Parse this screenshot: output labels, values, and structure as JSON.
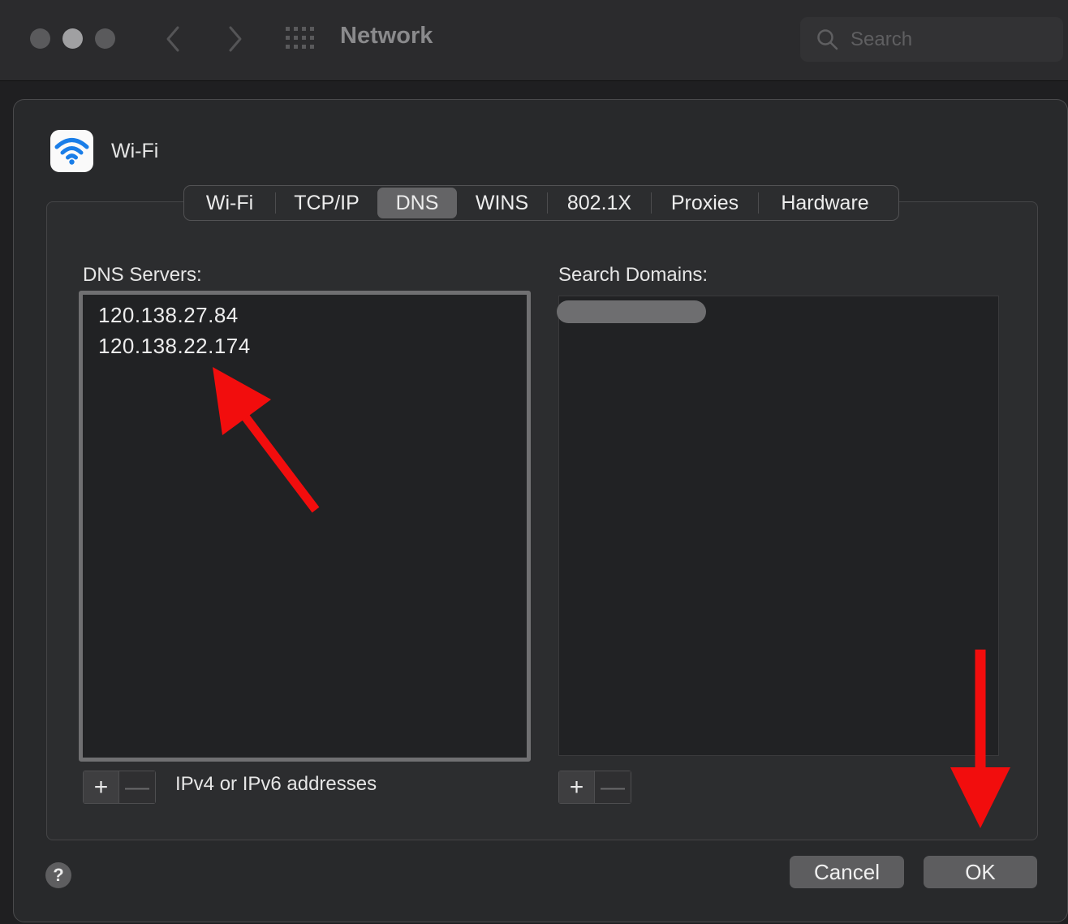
{
  "window": {
    "title": "Network",
    "search_placeholder": "Search",
    "icons": [
      "close-light",
      "minimize-light",
      "zoom-light",
      "back-icon",
      "forward-icon",
      "show-all-grid-icon",
      "search-icon"
    ]
  },
  "interface": {
    "name": "Wi-Fi",
    "icon": "wifi-icon",
    "icon_color": "#1a7ee8"
  },
  "tabs": [
    {
      "label": "Wi-Fi",
      "active": false
    },
    {
      "label": "TCP/IP",
      "active": false
    },
    {
      "label": "DNS",
      "active": true
    },
    {
      "label": "WINS",
      "active": false
    },
    {
      "label": "802.1X",
      "active": false
    },
    {
      "label": "Proxies",
      "active": false
    },
    {
      "label": "Hardware",
      "active": false
    }
  ],
  "dns": {
    "servers_label": "DNS Servers:",
    "servers": [
      "120.138.27.84",
      "120.138.22.174"
    ],
    "hint": "IPv4 or IPv6 addresses",
    "add_symbol": "+",
    "remove_symbol": "—"
  },
  "search_domains": {
    "label": "Search Domains:",
    "add_symbol": "+",
    "remove_symbol": "—"
  },
  "footer": {
    "help_symbol": "?",
    "cancel_label": "Cancel",
    "ok_label": "OK"
  },
  "annotations": {
    "arrow_color": "#f20d0d",
    "arrows": [
      "arrow-to-dns-servers",
      "arrow-to-ok-button"
    ]
  }
}
